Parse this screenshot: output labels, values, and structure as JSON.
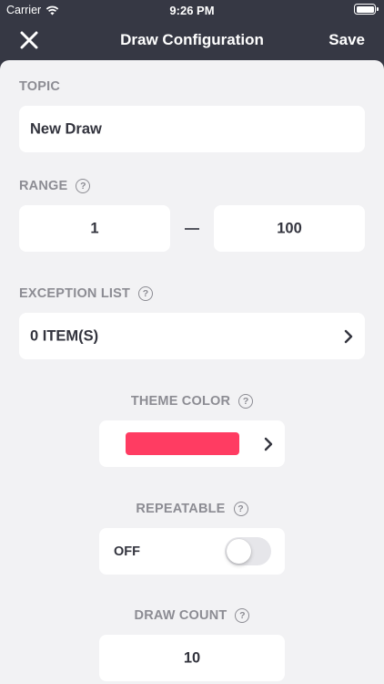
{
  "status_bar": {
    "carrier": "Carrier",
    "time": "9:26 PM"
  },
  "navbar": {
    "title": "Draw Configuration",
    "save_label": "Save",
    "close_icon": "close-icon"
  },
  "topic": {
    "label": "TOPIC",
    "value": "New Draw"
  },
  "range": {
    "label": "RANGE",
    "min": "1",
    "max": "100"
  },
  "exception_list": {
    "label": "EXCEPTION LIST",
    "value": "0 ITEM(S)"
  },
  "theme_color": {
    "label": "THEME COLOR",
    "color": "#ff3c62"
  },
  "repeatable": {
    "label": "REPEATABLE",
    "state": "OFF",
    "on": false
  },
  "draw_count": {
    "label": "DRAW COUNT",
    "value": "10"
  },
  "help_glyph": "?",
  "colors": {
    "navbar": "#363844",
    "background": "#f2f2f4",
    "label": "#8c8c93",
    "text": "#33343e"
  }
}
